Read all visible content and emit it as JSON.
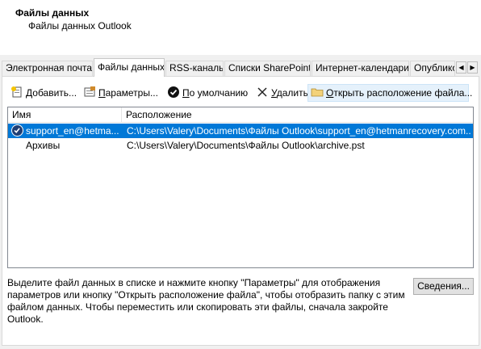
{
  "header": {
    "title": "Файлы данных",
    "subtitle": "Файлы данных Outlook"
  },
  "tabs": [
    {
      "label": "Электронная почта",
      "active": false
    },
    {
      "label": "Файлы данных",
      "active": true
    },
    {
      "label": "RSS-каналы",
      "active": false
    },
    {
      "label": "Списки SharePoint",
      "active": false
    },
    {
      "label": "Интернет-календари",
      "active": false
    },
    {
      "label": "Опублико",
      "active": false
    }
  ],
  "tab_scroll": {
    "left": "◀",
    "right": "▶"
  },
  "toolbar": {
    "add": {
      "hot": "Д",
      "rest": "обавить..."
    },
    "settings": {
      "hot": "П",
      "rest": "араметры..."
    },
    "default": {
      "hot": "П",
      "rest": "о умолчанию"
    },
    "delete": {
      "hot": "У",
      "rest": "далить"
    },
    "open_location": {
      "hot": "О",
      "rest": "ткрыть расположение файла..."
    }
  },
  "list": {
    "columns": [
      "Имя",
      "Расположение"
    ],
    "rows": [
      {
        "name": "support_en@hetma...",
        "location": "C:\\Users\\Valery\\Documents\\Файлы Outlook\\support_en@hetmanrecovery.com....",
        "selected": true,
        "default": true
      },
      {
        "name": "Архивы",
        "location": "C:\\Users\\Valery\\Documents\\Файлы Outlook\\archive.pst",
        "selected": false,
        "default": false
      }
    ]
  },
  "description": "Выделите файл данных в списке и нажмите кнопку \"Параметры\" для отображения параметров или кнопку \"Открыть расположение файла\", чтобы отобразить папку с этим файлом данных. Чтобы переместить или скопировать эти файлы, сначала закройте Outlook.",
  "details_button": "Сведения...",
  "colors": {
    "selection": "#0078d7",
    "panel_bg": "#f0f0f0",
    "hover": "#e5f1fb"
  }
}
